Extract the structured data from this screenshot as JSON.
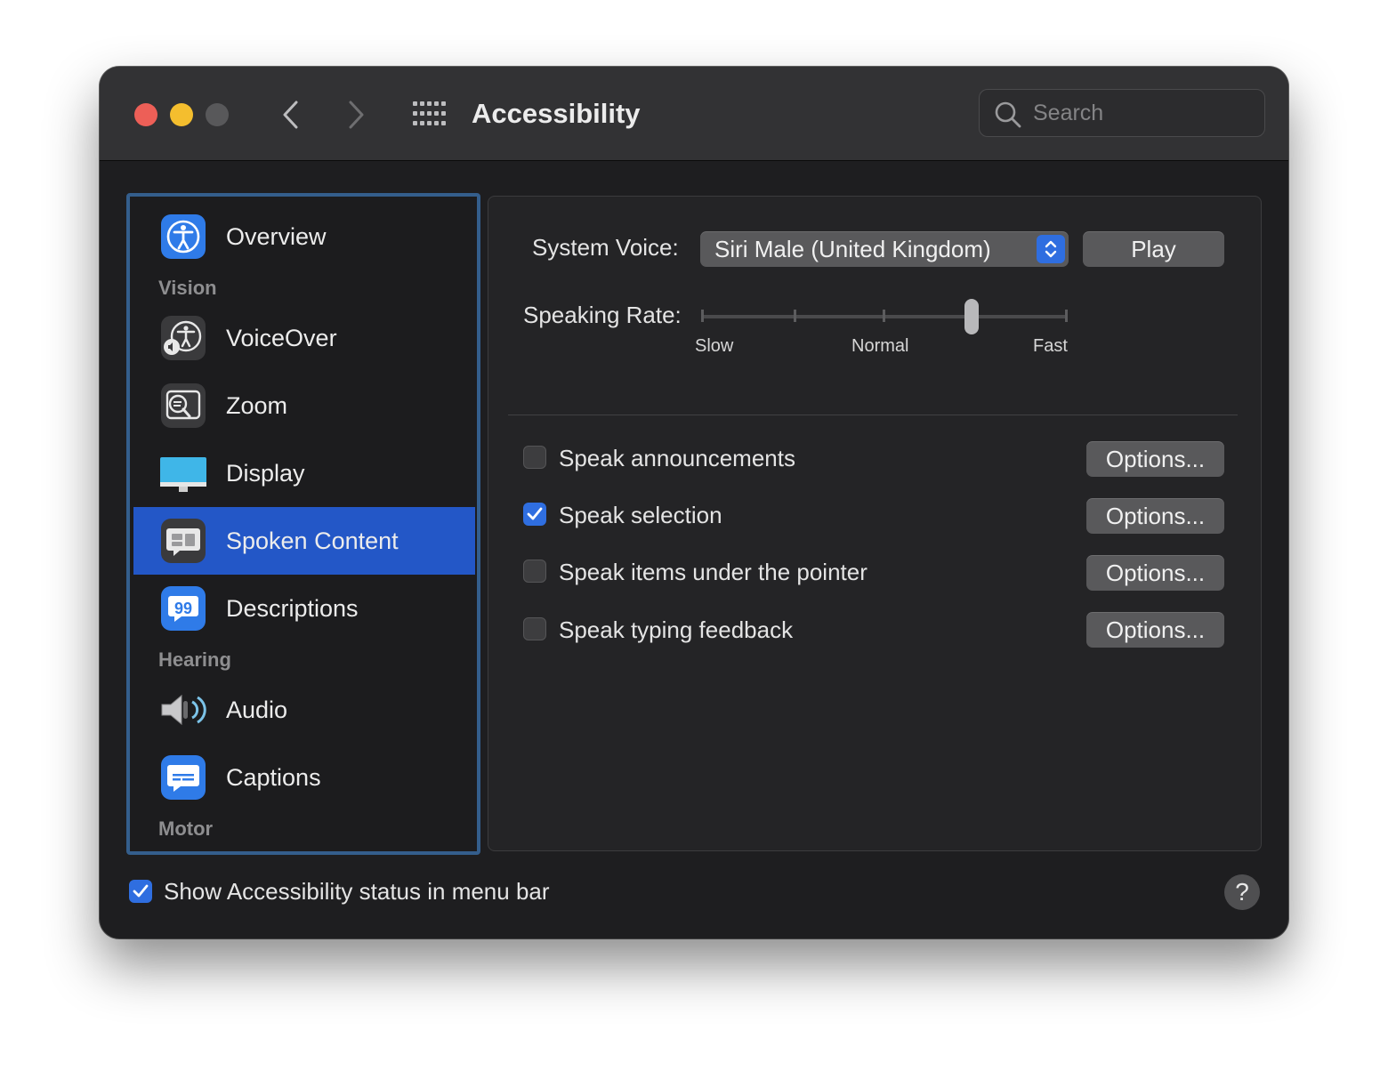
{
  "window": {
    "title": "Accessibility"
  },
  "search": {
    "placeholder": "Search"
  },
  "sidebar": {
    "items": [
      {
        "label": "Overview"
      },
      {
        "label": "VoiceOver"
      },
      {
        "label": "Zoom"
      },
      {
        "label": "Display"
      },
      {
        "label": "Spoken Content",
        "selected": true
      },
      {
        "label": "Descriptions"
      },
      {
        "label": "Audio"
      },
      {
        "label": "Captions"
      }
    ],
    "sections": {
      "vision": "Vision",
      "hearing": "Hearing",
      "motor": "Motor"
    }
  },
  "spoken": {
    "voice_label": "System Voice:",
    "voice_value": "Siri Male (United Kingdom)",
    "play_label": "Play",
    "rate_label": "Speaking Rate:",
    "rate_value": 0.74,
    "rate_ticks": [
      "Slow",
      "Normal",
      "Fast"
    ],
    "options": [
      {
        "label": "Speak announcements",
        "checked": false,
        "button": "Options..."
      },
      {
        "label": "Speak selection",
        "checked": true,
        "button": "Options..."
      },
      {
        "label": "Speak items under the pointer",
        "checked": false,
        "button": "Options..."
      },
      {
        "label": "Speak typing feedback",
        "checked": false,
        "button": "Options..."
      }
    ]
  },
  "footer": {
    "status_label": "Show Accessibility status in menu bar",
    "status_checked": true,
    "help": "?"
  },
  "colors": {
    "accent": "#2f6ee0",
    "selection": "#2357c7",
    "sidebar_border": "#345e8c"
  }
}
